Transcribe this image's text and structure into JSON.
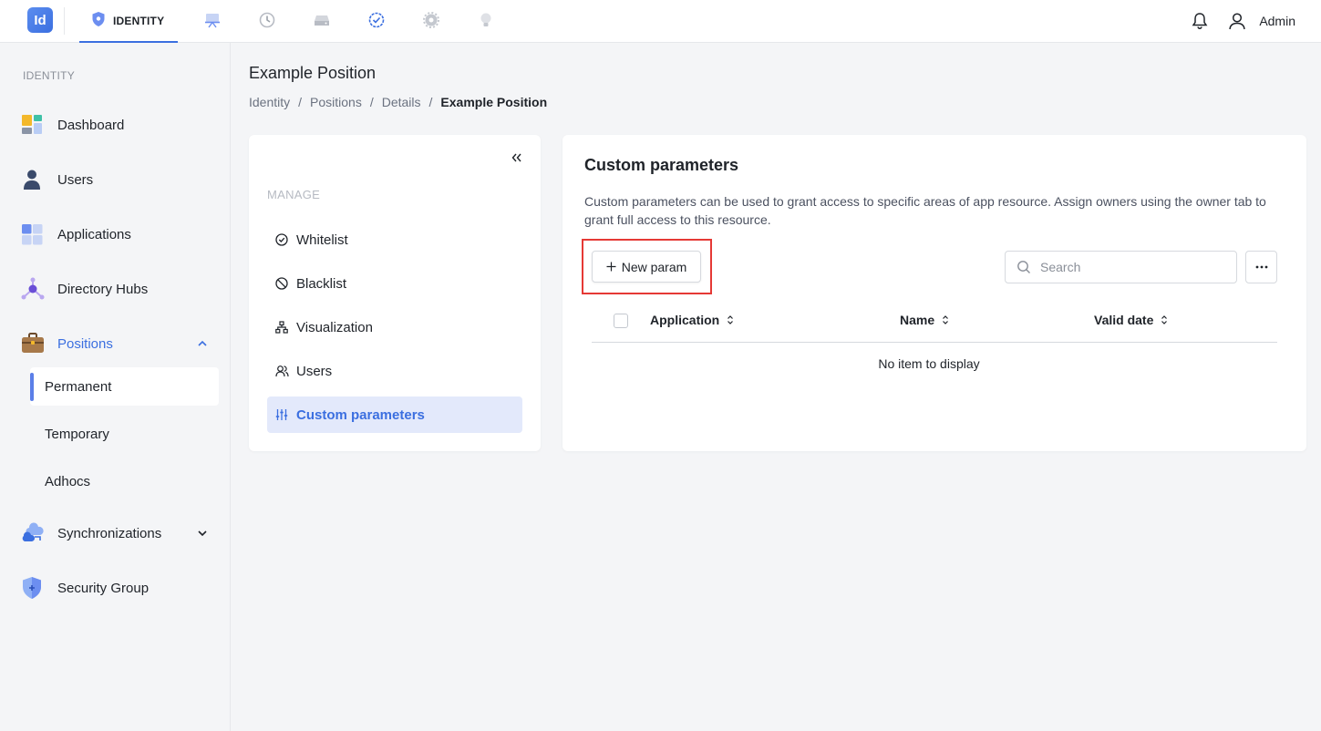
{
  "app": {
    "logo_text": "Id",
    "active_module": "IDENTITY",
    "user_name": "Admin",
    "accent": "#3b6fe0"
  },
  "topnav_icons": [
    "identity-shield-icon",
    "presentation-icon",
    "history-icon",
    "storage-icon",
    "check-badge-icon",
    "settings-gear-icon",
    "lightbulb-icon"
  ],
  "sidebar": {
    "section": "IDENTITY",
    "items": [
      {
        "label": "Dashboard",
        "icon": "dashboard-icon"
      },
      {
        "label": "Users",
        "icon": "user-icon"
      },
      {
        "label": "Applications",
        "icon": "applications-grid-icon"
      },
      {
        "label": "Directory Hubs",
        "icon": "hub-network-icon"
      },
      {
        "label": "Positions",
        "icon": "briefcase-icon"
      },
      {
        "label": "Synchronizations",
        "icon": "cloud-sync-icon"
      },
      {
        "label": "Security Group",
        "icon": "shield-icon"
      }
    ],
    "positions_sub": [
      "Permanent",
      "Temporary",
      "Adhocs"
    ]
  },
  "page": {
    "title": "Example Position",
    "breadcrumb": [
      "Identity",
      "Positions",
      "Details",
      "Example Position"
    ]
  },
  "manage": {
    "label": "MANAGE",
    "items": [
      {
        "label": "Whitelist",
        "icon": "check-circle-icon"
      },
      {
        "label": "Blacklist",
        "icon": "ban-icon"
      },
      {
        "label": "Visualization",
        "icon": "hierarchy-icon"
      },
      {
        "label": "Users",
        "icon": "users-icon"
      },
      {
        "label": "Custom parameters",
        "icon": "sliders-icon"
      }
    ]
  },
  "content": {
    "title": "Custom parameters",
    "description": "Custom parameters can be used to grant access to specific areas of app resource. Assign owners using the owner tab to grant full access to this resource.",
    "new_button": "New param",
    "search_placeholder": "Search",
    "columns": [
      "Application",
      "Name",
      "Valid date"
    ],
    "empty_text": "No item to display"
  }
}
